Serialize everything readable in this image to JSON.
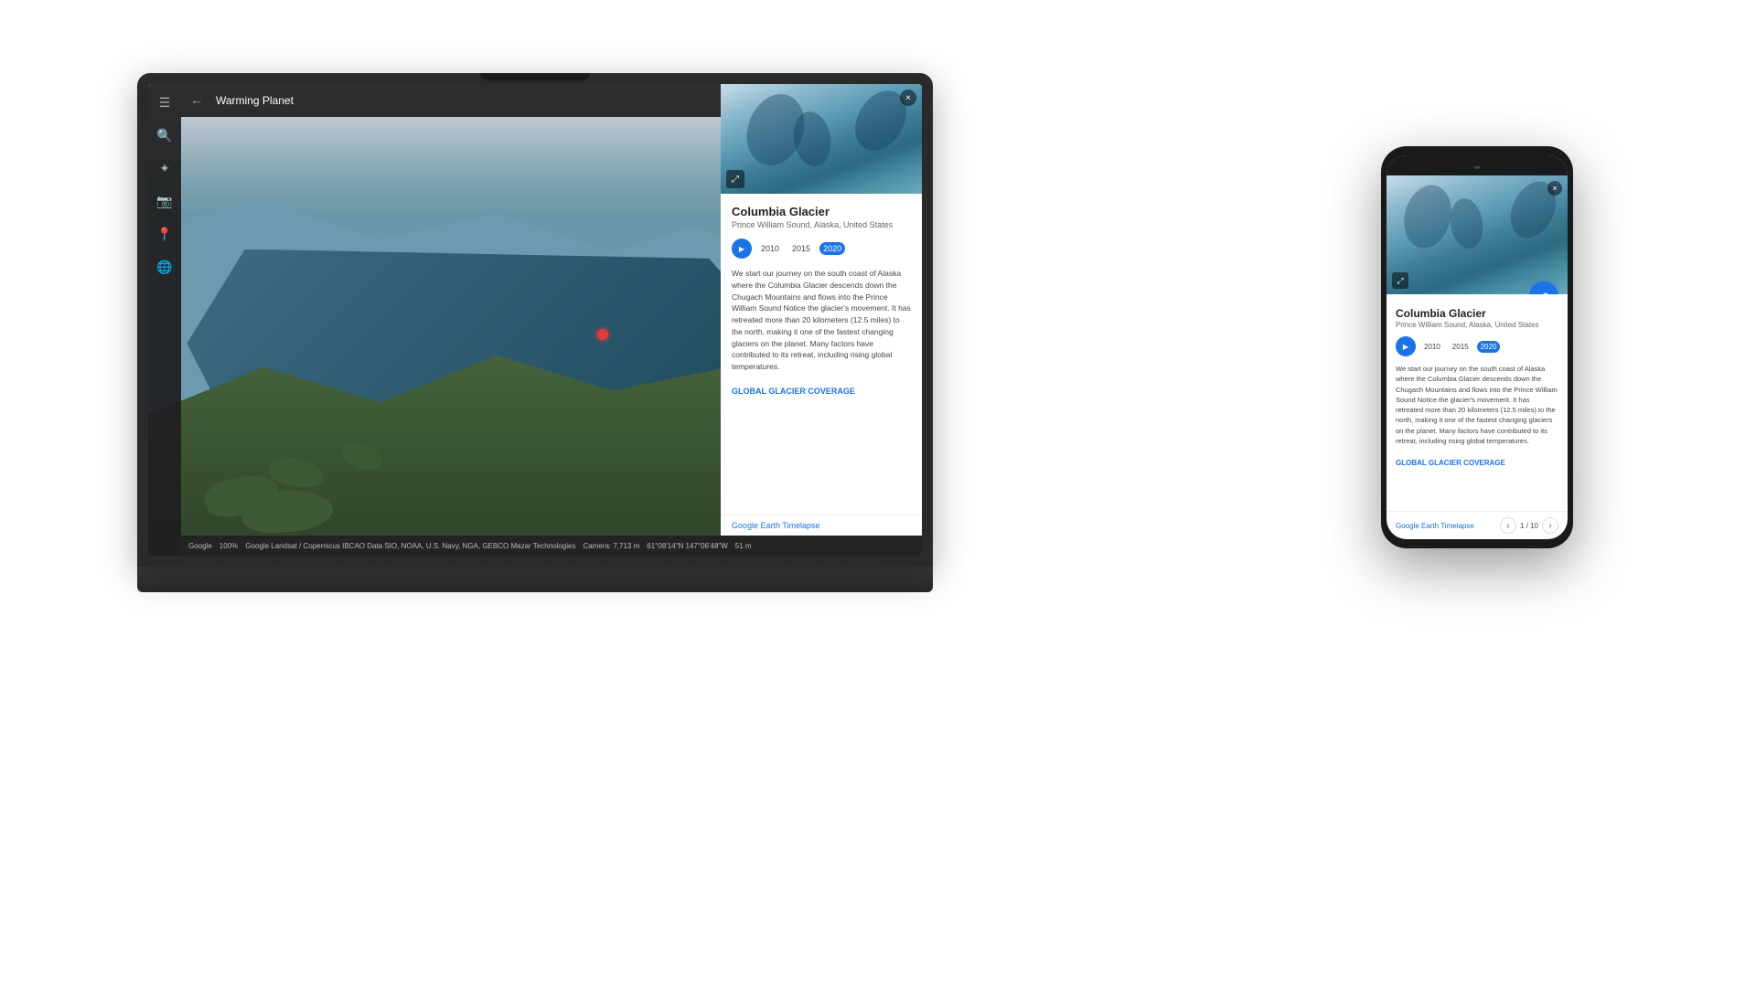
{
  "scene": {
    "background": "#ffffff"
  },
  "laptop": {
    "topbar": {
      "title": "Warming Planet",
      "menu_icon": "⋮",
      "back_icon": "←"
    },
    "statusbar": {
      "logo": "Google",
      "zoom": "100%",
      "attribution": "Google  Landsat / Copernicus  IBCAO  Data SIO, NOAA, U.S. Navy, NGA, GEBCO  Mazar Technologies",
      "camera": "Camera: 7,713 m",
      "coords": "61°08'14\"N 147°06'48\"W",
      "distance": "51 m"
    },
    "info_panel": {
      "title": "Columbia Glacier",
      "subtitle": "Prince William Sound, Alaska, United States",
      "timelapse_label": "Google Earth Timelapse",
      "years": [
        "2010",
        "2015",
        "2020"
      ],
      "active_year": "2020",
      "body_text": "We start our journey on the south coast of Alaska where the Columbia Glacier descends down the Chugach Mountains and flows into the Prince William Sound Notice the glacier's movement. It has retreated more than 20 kilometers (12.5 miles) to the north, making it one of the fastest changing glaciers on the planet. Many factors have contributed to its retreat, including rising global temperatures.",
      "global_glacier_link": "GLOBAL GLACIER COVERAGE",
      "close_icon": "×",
      "fullscreen_icon": "⤢"
    }
  },
  "phone": {
    "info_panel": {
      "title": "Columbia Glacier",
      "subtitle": "Prince William Sound, Alaska, United States",
      "timelapse_label": "Google Earth Timelapse",
      "years": [
        "2010",
        "2015",
        "2020"
      ],
      "active_year": "2020",
      "body_text": "We start our journey on the south coast of Alaska where the Columbia Glacier descends down the Chugach Mountains and flows into the Prince William Sound Notice the glacier's movement. It has retreated more than 20 kilometers (12.5 miles) to the north, making it one of the fastest changing glaciers on the planet. Many factors have contributed to its retreat, including rising global temperatures.",
      "global_glacier_link": "GLOBAL GLACIER COVERAGE",
      "pagination": "1 / 10",
      "close_icon": "×",
      "share_icon": "▶",
      "expand_icon": "⤢",
      "prev_icon": "‹",
      "next_icon": "›"
    }
  }
}
